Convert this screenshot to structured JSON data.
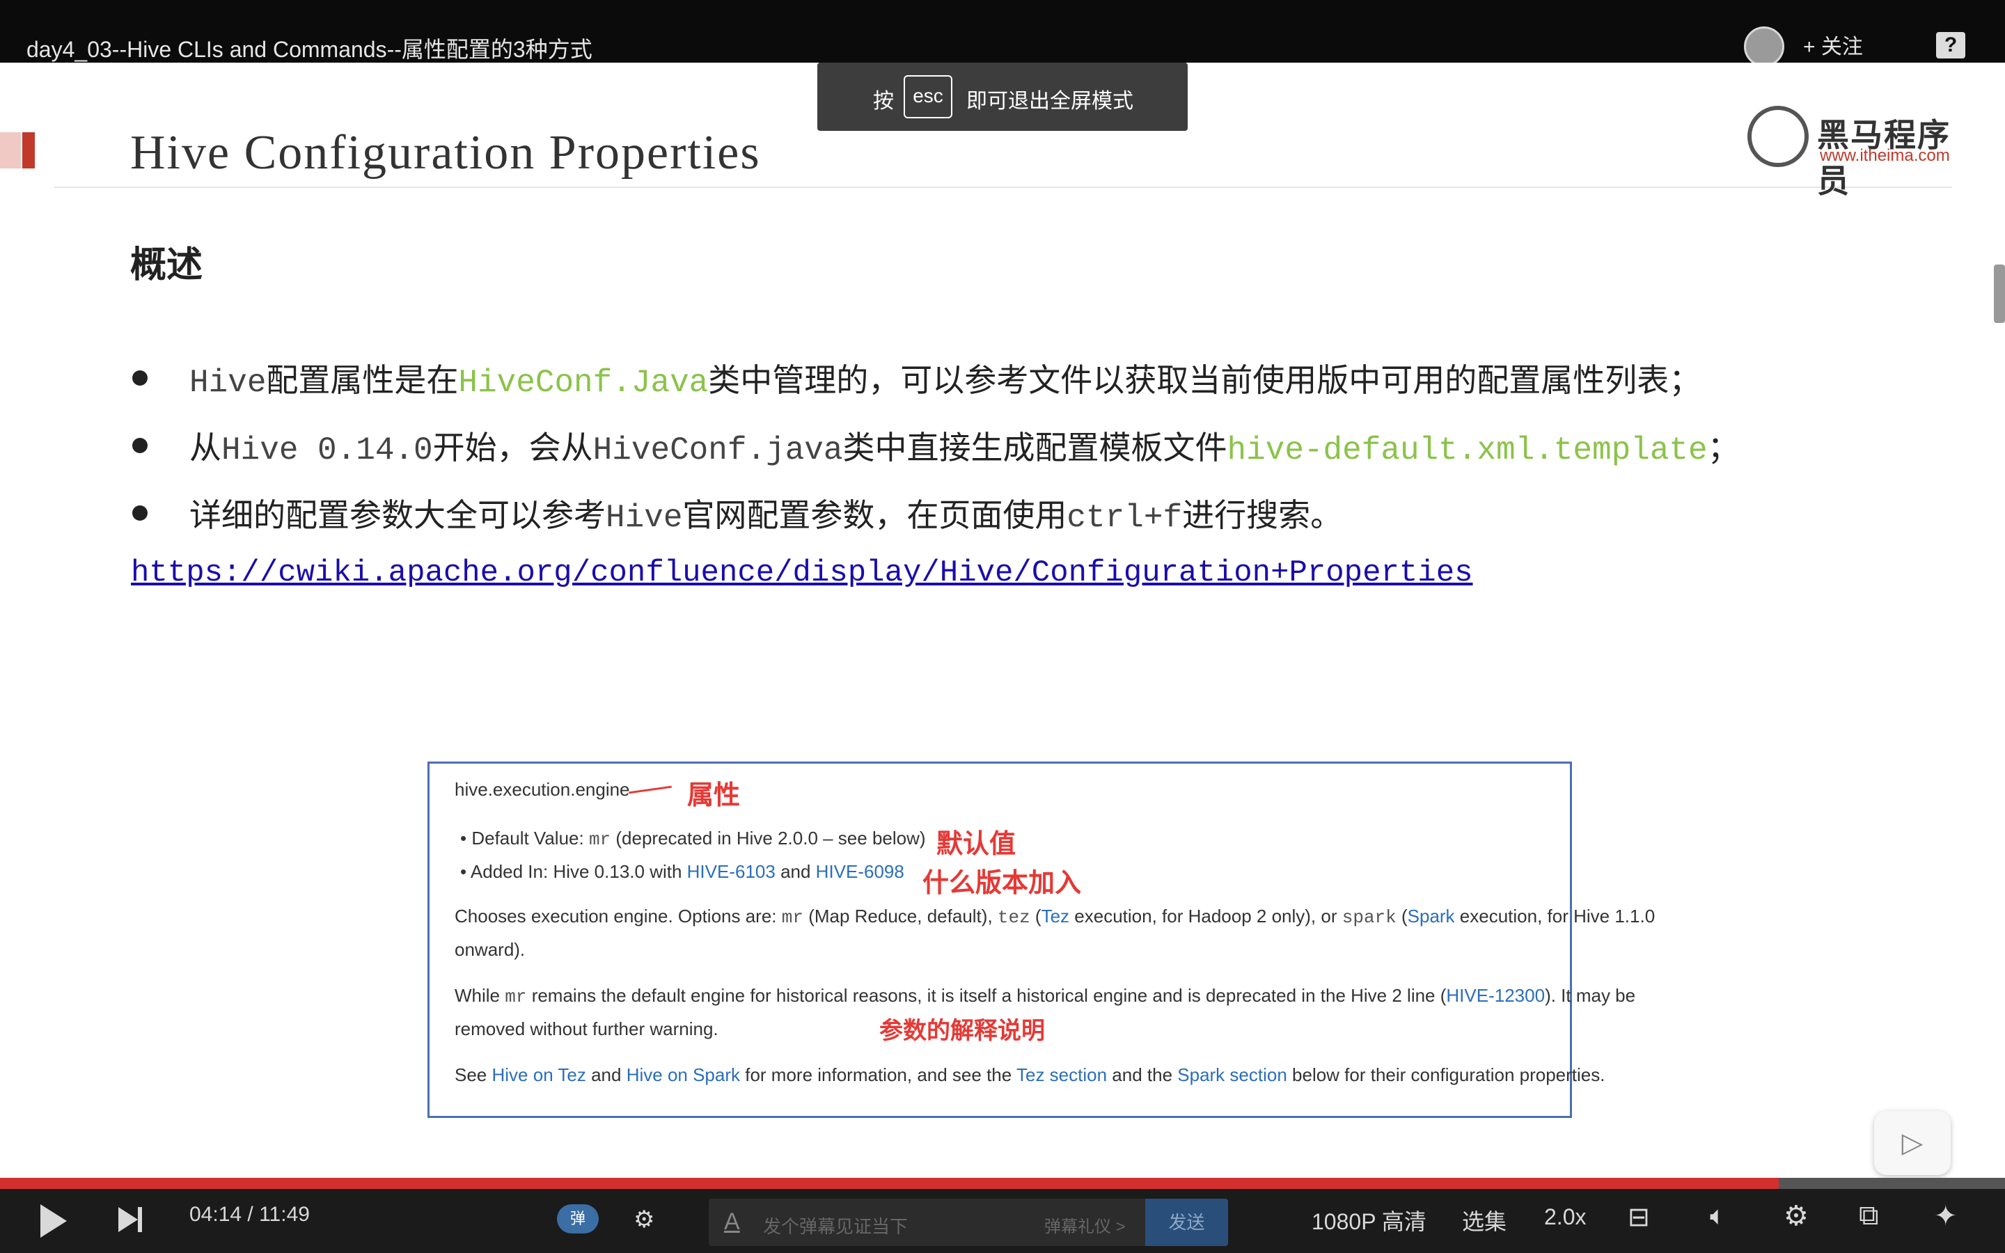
{
  "topbar": {
    "video_title": "day4_03--Hive CLIs and Commands--属性配置的3种方式",
    "follow_label": "+ 关注",
    "help_label": "?"
  },
  "toast": {
    "prefix": "按",
    "key": "esc",
    "suffix": "即可退出全屏模式"
  },
  "slide": {
    "title": "Hive Configuration Properties",
    "logo_text": "黑马程序员",
    "logo_url": "www.itheima.com",
    "heading": "概述",
    "bullets": [
      {
        "p1": "Hive",
        "p2": "配置属性是在",
        "p3": "HiveConf.Java",
        "p4": "类中管理的，可以参考文件以获取当前使用版中可用的配置属性列表；"
      },
      {
        "p1": "从",
        "p2": "Hive 0.14.0",
        "p3": "开始，会从",
        "p4": "HiveConf.java",
        "p5": "类中直接生成配置模板文件",
        "p6": "hive-default.xml.template",
        "p7": "；"
      },
      {
        "p1": "详细的配置参数大全可以参考",
        "p2": "Hive",
        "p3": "官网配置参数，在页面使用",
        "p4": "ctrl+f",
        "p5": "进行搜索。"
      }
    ],
    "link": "https://cwiki.apache.org/confluence/display/Hive/Configuration+Properties",
    "doc": {
      "property_name": "hive.execution.engine",
      "default_label": "Default Value: ",
      "default_code": "mr",
      "default_rest": " (deprecated in Hive 2.0.0 – see below)",
      "added_prefix": "Added In: Hive 0.13.0 with ",
      "added_link1": "HIVE-6103",
      "added_and": " and ",
      "added_link2": "HIVE-6098",
      "desc1_a": "Chooses execution engine. Options are: ",
      "desc1_mr": "mr",
      "desc1_b": " (Map Reduce, default), ",
      "desc1_tez": "tez",
      "desc1_c": " (",
      "desc1_tezlink": "Tez",
      "desc1_d": " execution, for Hadoop 2 only), or ",
      "desc1_spark": "spark",
      "desc1_e": " (",
      "desc1_sparklink": "Spark",
      "desc1_f": " execution, for Hive 1.1.0",
      "desc1_line2": "onward).",
      "desc2_a": "While ",
      "desc2_mr": "mr",
      "desc2_b": " remains the default engine for historical reasons, it is itself a historical engine and is deprecated in the Hive 2 line (",
      "desc2_link": "HIVE-12300",
      "desc2_c": "). It may be",
      "desc2_line2": "removed without further warning.",
      "see_a": "See ",
      "see_link1": "Hive on Tez",
      "see_and": " and ",
      "see_link2": "Hive on Spark",
      "see_b": " for more information, and see the ",
      "see_link3": "Tez section",
      "see_c": " and the ",
      "see_link4": "Spark section",
      "see_d": " below for their configuration properties."
    },
    "annotations": {
      "property": "属性",
      "default": "默认值",
      "version": "什么版本加入",
      "explanation": "参数的解释说明"
    }
  },
  "player": {
    "current_time": "04:14",
    "total_time": "11:49",
    "time_separator": " / ",
    "progress_fraction": 0.887,
    "danmaku_toggle": "弹",
    "danmaku_placeholder": "发个弹幕见证当下",
    "danmaku_gift": "弹幕礼仪 >",
    "send_label": "发送",
    "quality": "1080P 高清",
    "episodes": "选集",
    "speed": "2.0x"
  },
  "colors": {
    "accent_red": "#c0392b",
    "highlight_green": "#8bc34a",
    "link_blue": "#1a0dab",
    "progress_red": "#d32f2f"
  }
}
